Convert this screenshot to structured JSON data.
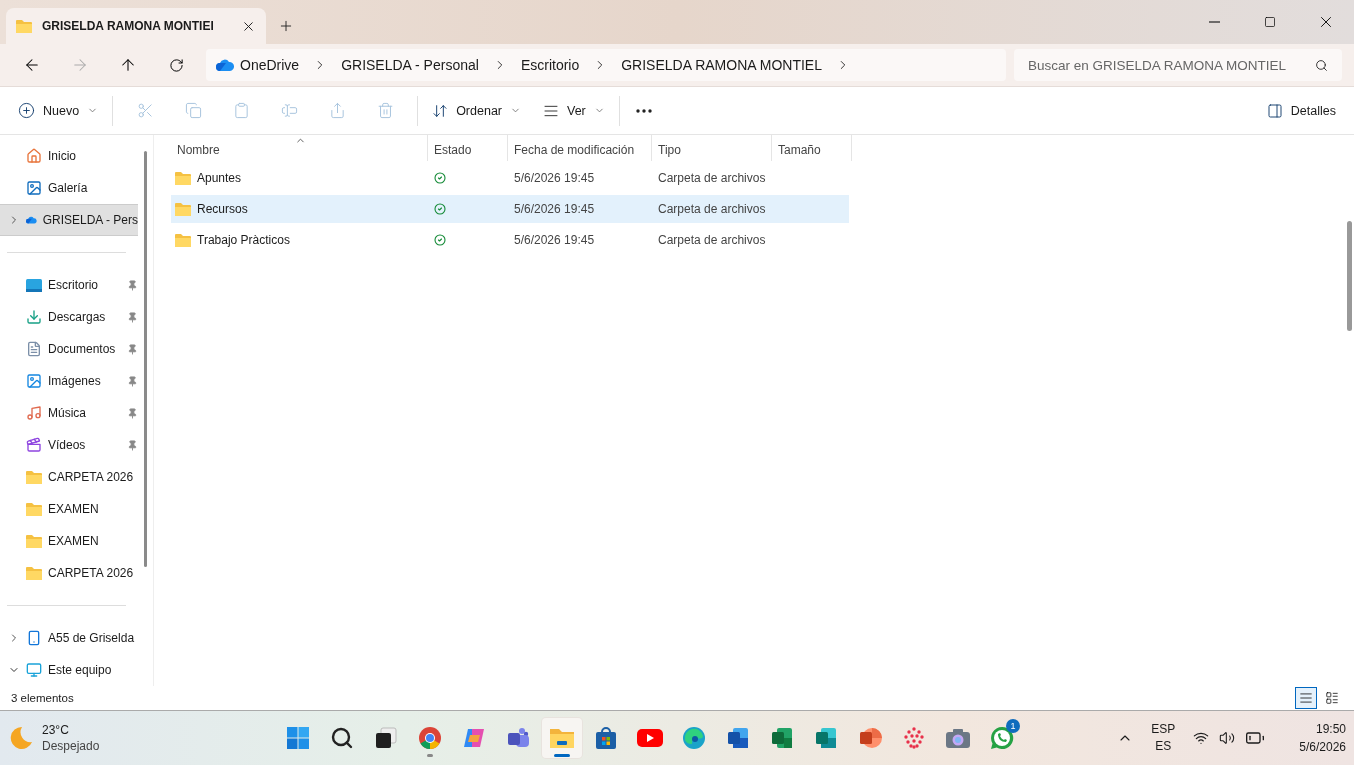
{
  "tabs": [
    {
      "label": "GRISELDA RAMONA MONTIEI",
      "selected": true
    }
  ],
  "breadcrumb": [
    "OneDrive",
    "GRISELDA - Personal",
    "Escritorio",
    "GRISELDA RAMONA MONTIEL"
  ],
  "search": {
    "placeholder": "Buscar en GRISELDA RAMONA MONTIEL"
  },
  "toolbar": {
    "new_label": "Nuevo",
    "actions": [
      {
        "kind": "cut",
        "disabled": true
      },
      {
        "kind": "copy",
        "disabled": true
      },
      {
        "kind": "paste",
        "disabled": true
      },
      {
        "kind": "rename",
        "disabled": true
      },
      {
        "kind": "share",
        "disabled": true
      },
      {
        "kind": "delete",
        "disabled": true
      }
    ],
    "sort_label": "Ordenar",
    "view_label": "Ver",
    "details_label": "Detalles"
  },
  "sidebar": {
    "groups": [
      [
        {
          "label": "Inicio",
          "kind": "home",
          "pinned": false,
          "selected": false
        },
        {
          "label": "Galería",
          "kind": "gallery",
          "pinned": false,
          "selected": false
        },
        {
          "label": "GRISELDA - Pers",
          "kind": "cloud",
          "pinned": false,
          "selected": true,
          "expanded": false
        }
      ],
      [
        {
          "label": "Escritorio",
          "kind": "desktop",
          "pinned": true,
          "selected": false
        },
        {
          "label": "Descargas",
          "kind": "download",
          "pinned": true,
          "selected": false
        },
        {
          "label": "Documentos",
          "kind": "docs",
          "pinned": true,
          "selected": false
        },
        {
          "label": "Imágenes",
          "kind": "images",
          "pinned": true,
          "selected": false
        },
        {
          "label": "Música",
          "kind": "music",
          "pinned": true,
          "selected": false
        },
        {
          "label": "Vídeos",
          "kind": "videos",
          "pinned": true,
          "selected": false
        },
        {
          "label": "CARPETA 2026",
          "kind": "folder",
          "pinned": false,
          "selected": false
        },
        {
          "label": "EXAMEN",
          "kind": "folder",
          "pinned": false,
          "selected": false
        },
        {
          "label": "EXAMEN",
          "kind": "folder",
          "pinned": false,
          "selected": false
        },
        {
          "label": "CARPETA 2026",
          "kind": "folder",
          "pinned": false,
          "selected": false
        }
      ],
      [
        {
          "label": "A55 de Griselda",
          "kind": "phone",
          "pinned": false,
          "selected": false,
          "expanded": false
        },
        {
          "label": "Este equipo",
          "kind": "pc",
          "pinned": false,
          "selected": false,
          "expanded": true
        }
      ]
    ]
  },
  "columns": [
    {
      "label": "Nombre",
      "sorted": true
    },
    {
      "label": "Estado",
      "sorted": false
    },
    {
      "label": "Fecha de modificación",
      "sorted": false
    },
    {
      "label": "Tipo",
      "sorted": false
    },
    {
      "label": "Tamaño",
      "sorted": false
    }
  ],
  "rows": [
    {
      "name": "Apuntes",
      "synced": true,
      "date": "5/6/2026 19:45",
      "type": "Carpeta de archivos",
      "selected": false
    },
    {
      "name": "Recursos",
      "synced": true,
      "date": "5/6/2026 19:45",
      "type": "Carpeta de archivos",
      "selected": true
    },
    {
      "name": "Trabajo Pràcticos",
      "synced": true,
      "date": "5/6/2026 19:45",
      "type": "Carpeta de archivos",
      "selected": false
    }
  ],
  "status_bar": {
    "count": "3 elementos",
    "views": [
      {
        "kind": "details",
        "selected": true
      },
      {
        "kind": "tiles",
        "selected": false
      }
    ]
  },
  "taskbar": {
    "weather": {
      "temp": "23°C",
      "condition": "Despejado"
    },
    "apps": [
      {
        "kind": "start",
        "active": false,
        "running": false
      },
      {
        "kind": "search",
        "active": false,
        "running": false
      },
      {
        "kind": "taskview",
        "active": false,
        "running": false
      },
      {
        "kind": "chrome",
        "active": false,
        "running": true
      },
      {
        "kind": "copilot",
        "active": false,
        "running": false
      },
      {
        "kind": "teams",
        "active": false,
        "running": false
      },
      {
        "kind": "explorer",
        "active": true,
        "running": true
      },
      {
        "kind": "store",
        "active": false,
        "running": false
      },
      {
        "kind": "youtube",
        "active": false,
        "running": false
      },
      {
        "kind": "edge",
        "active": false,
        "running": false
      },
      {
        "kind": "word",
        "active": false,
        "running": false
      },
      {
        "kind": "excel",
        "active": false,
        "running": false
      },
      {
        "kind": "publisher",
        "active": false,
        "running": false
      },
      {
        "kind": "powerpoint",
        "active": false,
        "running": false
      },
      {
        "kind": "dots",
        "active": false,
        "running": false
      },
      {
        "kind": "camera",
        "active": false,
        "running": false
      },
      {
        "kind": "whatsapp",
        "active": false,
        "running": false,
        "badge": "1"
      }
    ],
    "lang": "ESP",
    "layout": "ES",
    "time": "19:50",
    "date": "5/6/2026"
  }
}
